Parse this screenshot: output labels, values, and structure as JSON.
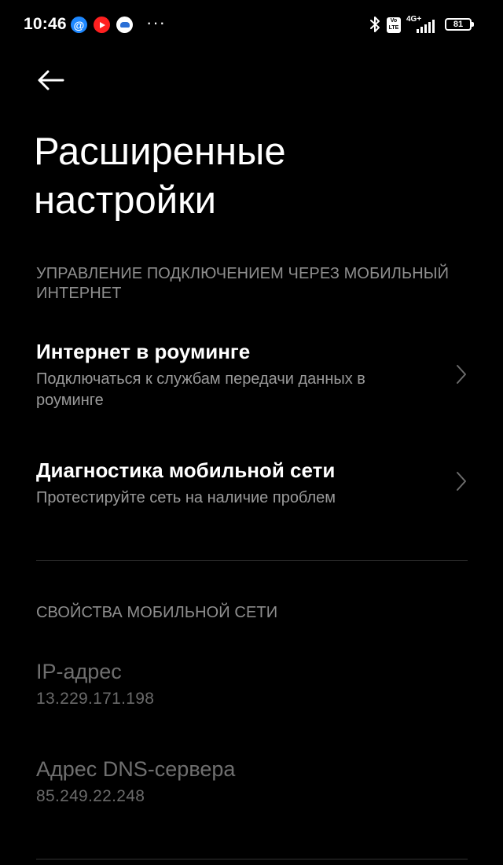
{
  "status_bar": {
    "time": "10:46",
    "more": "···",
    "volte_top": "Vo",
    "volte_bottom": "LTE",
    "network": "4G+",
    "battery": "81",
    "app_icons": [
      "at-sign-icon",
      "youtube-icon",
      "cloud-app-icon"
    ]
  },
  "header": {
    "title": "Расширенные настройки"
  },
  "sections": [
    {
      "header": "УПРАВЛЕНИЕ ПОДКЛЮЧЕНИЕМ ЧЕРЕЗ МОБИЛЬНЫЙ ИНТЕРНЕТ",
      "items": [
        {
          "title": "Интернет в роуминге",
          "subtitle": "Подключаться к службам передачи данных в роуминге"
        },
        {
          "title": "Диагностика мобильной сети",
          "subtitle": "Протестируйте сеть на наличие проблем"
        }
      ]
    },
    {
      "header": "СВОЙСТВА МОБИЛЬНОЙ СЕТИ",
      "items": [
        {
          "title": "IP-адрес",
          "value": "13.229.171.198"
        },
        {
          "title": "Адрес DNS-сервера",
          "value": "85.249.22.248"
        }
      ]
    }
  ],
  "colors": {
    "background": "#000000",
    "primary_text": "#ffffff",
    "secondary_text": "#9a9a9a",
    "disabled_text": "#6f6f6f",
    "divider": "#333333"
  }
}
